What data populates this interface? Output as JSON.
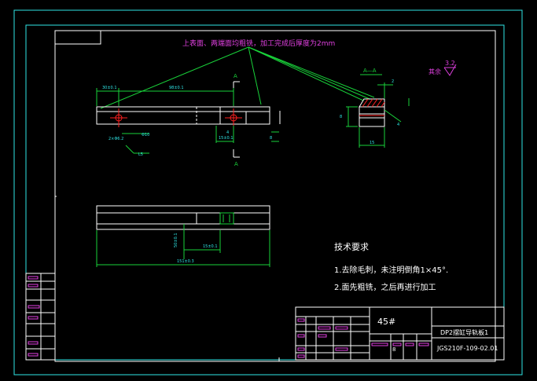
{
  "colors": {
    "background": "#000000",
    "border": "#2fe6e6",
    "geometry": "#ffffff",
    "dimension": "#19d23a",
    "annotation": "#e040e0",
    "centerline": "#ff2020",
    "dim_text": "#3050ff"
  },
  "notes": {
    "surface_note": "上表面、两端面均粗铣，加工完成后厚度为2mm",
    "roughness_label": "其余",
    "roughness_value": "3.2",
    "section_label": "A—A",
    "section_marker_top": "A",
    "section_marker_bottom": "A"
  },
  "tech_requirements": {
    "title": "技术要求",
    "item1": "1.去除毛刺，未注明倒角1×45°.",
    "item2": "2.面先粗铣，之后再进行加工"
  },
  "title_block": {
    "material": "45#",
    "part_name": "DP2摆缸导轨板1",
    "drawing_no": "JGS210F-109-02.01",
    "scale_value": "8"
  },
  "dimensions": {
    "d_30": "30±0.1",
    "d_98": "98±0.1",
    "d_phi": "Φ10",
    "d_15": "15",
    "d_hole": "2×Φ6.2",
    "d_l5": "L5",
    "d_15b": "15±0.1",
    "d_4": "4",
    "d_8": "8",
    "d_30b": "30±0.1",
    "d_sec_w": "15",
    "d_sec_h": "8",
    "d_sec_t": "2",
    "d_sec_a": "4",
    "d_bot_15": "15±0.1",
    "d_bot_50": "50±0.1",
    "d_bot_151": "151±0.3"
  }
}
